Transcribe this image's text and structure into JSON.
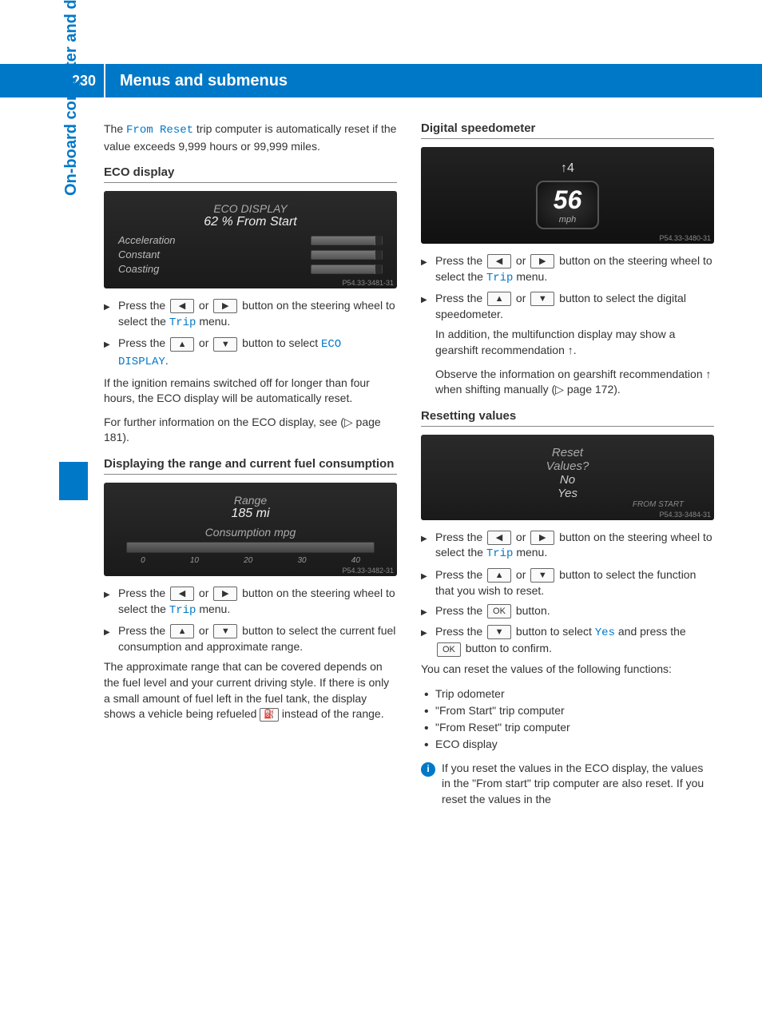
{
  "page_number": "230",
  "header": "Menus and submenus",
  "side_tab": "On-board computer and displays",
  "col1": {
    "intro_1": "The ",
    "intro_special": "From Reset",
    "intro_2": " trip computer is automatically reset if the value exceeds 9,999 hours or 99,999 miles.",
    "h_eco": "ECO display",
    "eco_disp": {
      "title": "ECO DISPLAY",
      "pct": "62 % From Start",
      "r1": "Acceleration",
      "r2": "Constant",
      "r3": "Coasting",
      "code": "P54.33-3481-31"
    },
    "eco_step1_a": "Press the ",
    "eco_step1_b": " or ",
    "eco_step1_c": " button on the steering wheel to select the ",
    "trip_menu": "Trip",
    "eco_step1_d": " menu.",
    "eco_step2_a": "Press the ",
    "eco_step2_b": " or ",
    "eco_step2_c": " button to select ",
    "eco_display_special": "ECO DISPLAY",
    "eco_step2_d": ".",
    "eco_p1": "If the ignition remains switched off for longer than four hours, the ECO display will be automatically reset.",
    "eco_p2": "For further information on the ECO display, see (▷ page 181).",
    "h_range": "Displaying the range and current fuel consumption",
    "range_disp": {
      "l1": "Range",
      "l2": "185 mi",
      "l3": "Consumption mpg",
      "ticks": [
        "0",
        "10",
        "20",
        "30",
        "40"
      ],
      "code": "P54.33-3482-31"
    },
    "range_step1_a": "Press the ",
    "range_step1_b": " or ",
    "range_step1_c": " button on the steering wheel to select the ",
    "range_step1_d": " menu.",
    "range_step2_a": "Press the ",
    "range_step2_b": " or ",
    "range_step2_c": " button to select the current fuel consumption and approximate range.",
    "range_p_a": "The approximate range that can be covered depends on the fuel level and your current driving style. If there is only a small amount of fuel left in the fuel tank, the display shows a vehicle being refueled ",
    "range_p_b": " instead of the range."
  },
  "col2": {
    "h_speedo": "Digital speedometer",
    "speedo": {
      "gear": "↑4",
      "speed": "56",
      "unit": "mph",
      "code": "P54.33-3480-31"
    },
    "sp_step1_a": "Press the ",
    "sp_step1_b": " or ",
    "sp_step1_c": " button on the steering wheel to select the ",
    "sp_step1_d": " menu.",
    "sp_step2_a": "Press the ",
    "sp_step2_b": " or ",
    "sp_step2_c": " button to select the digital speedometer.",
    "sp_p1": "In addition, the multifunction display may show a gearshift recommendation ↑.",
    "sp_p2": "Observe the information on gearshift recommendation ↑ when shifting manually (▷ page 172).",
    "h_reset": "Resetting values",
    "reset_disp": {
      "l1": "Reset",
      "l2": "Values?",
      "l3": "No",
      "l4": "Yes",
      "from": "FROM START",
      "code": "P54.33-3484-31"
    },
    "rs_step1_a": "Press the ",
    "rs_step1_b": " or ",
    "rs_step1_c": " button on the steering wheel to select the ",
    "rs_step1_d": " menu.",
    "rs_step2_a": "Press the ",
    "rs_step2_b": " or ",
    "rs_step2_c": " button to select the function that you wish to reset.",
    "rs_step3_a": "Press the ",
    "ok_label": "OK",
    "rs_step3_b": " button.",
    "rs_step4_a": "Press the ",
    "rs_step4_b": " button to select ",
    "yes_special": "Yes",
    "rs_step4_c": " and press the ",
    "rs_step4_d": " button to confirm.",
    "rs_p": "You can reset the values of the following functions:",
    "rs_list": [
      "Trip odometer",
      "\"From Start\" trip computer",
      "\"From Reset\" trip computer",
      "ECO display"
    ],
    "rs_note": "If you reset the values in the ECO display, the values in the \"From start\" trip computer are also reset. If you reset the values in the"
  },
  "keys": {
    "left": "◀",
    "right": "▶",
    "up": "▲",
    "down": "▼"
  }
}
